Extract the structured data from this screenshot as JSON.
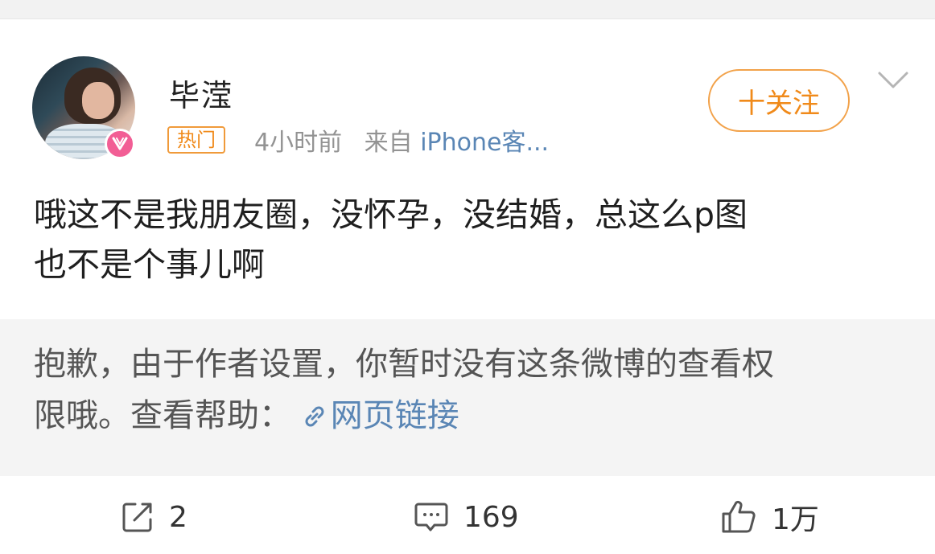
{
  "post": {
    "username": "毕滢",
    "hot_tag": "热门",
    "time": "4小时前",
    "from_prefix": "来自",
    "source": "iPhone客...",
    "follow_label": "十关注",
    "text_line1": "哦这不是我朋友圈，没怀孕，没结婚，总这么p图",
    "text_line2": "也不是个事儿啊"
  },
  "notice": {
    "line1": "抱歉，由于作者设置，你暂时没有这条微博的查看权",
    "line2_prefix": "限哦。查看帮助：",
    "link_label": "网页链接"
  },
  "actions": {
    "repost_count": "2",
    "comment_count": "169",
    "like_count": "1万"
  },
  "icons": {
    "vip": "vip-badge-icon",
    "more": "chevron-down-icon",
    "link": "link-icon",
    "repost": "share-icon",
    "comment": "comment-icon",
    "like": "thumbs-up-icon"
  },
  "colors": {
    "accent_orange": "#f08a1a",
    "link_blue": "#5a86b5",
    "vip_pink": "#f25e95"
  }
}
